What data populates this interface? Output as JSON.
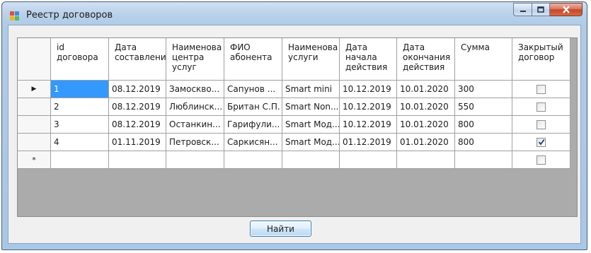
{
  "window": {
    "title": "Реестр договоров"
  },
  "columns": [
    "id договора",
    "Дата составлени",
    "Наименова центра услуг",
    "ФИО абонента",
    "Наименова услуги",
    "Дата начала действия",
    "Дата окончания действия",
    "Сумма",
    "Закрытый договор"
  ],
  "rows": [
    {
      "id": "1",
      "date": "08.12.2019",
      "center": "Замоскво...",
      "fio": "Сапунов ...",
      "service": "Smart mini",
      "start": "10.12.2019",
      "end": "10.01.2020",
      "sum": "300",
      "closed": false
    },
    {
      "id": "2",
      "date": "08.12.2019",
      "center": "Люблинск...",
      "fio": "Британ С.П.",
      "service": "Smart Non...",
      "start": "10.12.2019",
      "end": "10.01.2020",
      "sum": "550",
      "closed": false
    },
    {
      "id": "3",
      "date": "08.12.2019",
      "center": "Останкин...",
      "fio": "Гарифули...",
      "service": "Smart Мод...",
      "start": "10.12.2019",
      "end": "10.01.2020",
      "sum": "800",
      "closed": false
    },
    {
      "id": "4",
      "date": "01.11.2019",
      "center": "Петровск...",
      "fio": "Саркисян...",
      "service": "Smart Мод...",
      "start": "01.12.2019",
      "end": "01.01.2020",
      "sum": "800",
      "closed": true
    }
  ],
  "row_indicators": {
    "current": "▶",
    "new": "*"
  },
  "buttons": {
    "find": "Найти"
  },
  "colors": {
    "selection": "#3399ff",
    "grid_background": "#ababab",
    "close_button": "#c6462b"
  }
}
